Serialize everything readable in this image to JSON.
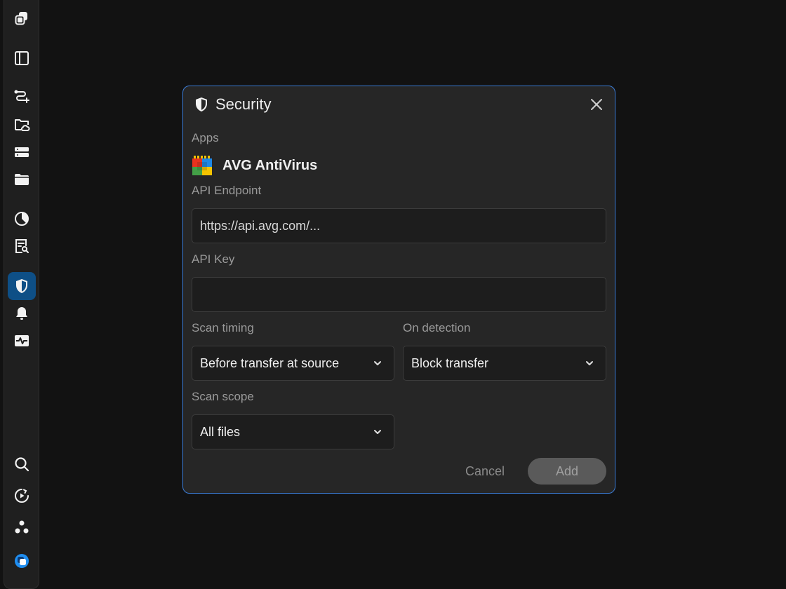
{
  "sidebar": {
    "items": [
      {
        "name": "app-logo-icon",
        "icon": "stacked-squares"
      },
      {
        "name": "panel-toggle-icon",
        "icon": "sidebar-panel"
      },
      {
        "name": "transfers-icon",
        "icon": "route-add"
      },
      {
        "name": "cloud-folder-icon",
        "icon": "folder-cloud"
      },
      {
        "name": "servers-icon",
        "icon": "server-stack"
      },
      {
        "name": "folder-icon",
        "icon": "folder"
      },
      {
        "name": "reports-icon",
        "icon": "pie-chart"
      },
      {
        "name": "logs-icon",
        "icon": "document-search"
      },
      {
        "name": "security-icon",
        "icon": "shield",
        "active": true
      },
      {
        "name": "notifications-icon",
        "icon": "bell"
      },
      {
        "name": "monitoring-icon",
        "icon": "activity-pulse"
      },
      {
        "name": "search-icon",
        "icon": "magnifier"
      },
      {
        "name": "automation-icon",
        "icon": "play-circle"
      },
      {
        "name": "community-icon",
        "icon": "three-dots-cluster"
      },
      {
        "name": "brand-icon",
        "icon": "brand-circle"
      }
    ],
    "active_color": "#0e4f86"
  },
  "dialog": {
    "title": "Security",
    "title_icon": "shield-icon",
    "close_icon": "close-icon",
    "border_color": "#3a7bd5",
    "apps_label": "Apps",
    "app_name": "AVG AntiVirus",
    "api_endpoint_label": "API Endpoint",
    "api_endpoint_value": "https://api.avg.com/...",
    "api_key_label": "API Key",
    "api_key_value": "",
    "scan_timing_label": "Scan timing",
    "scan_timing_value": "Before transfer at source",
    "on_detection_label": "On detection",
    "on_detection_value": "Block transfer",
    "scan_scope_label": "Scan scope",
    "scan_scope_value": "All files",
    "cancel_label": "Cancel",
    "add_label": "Add"
  }
}
